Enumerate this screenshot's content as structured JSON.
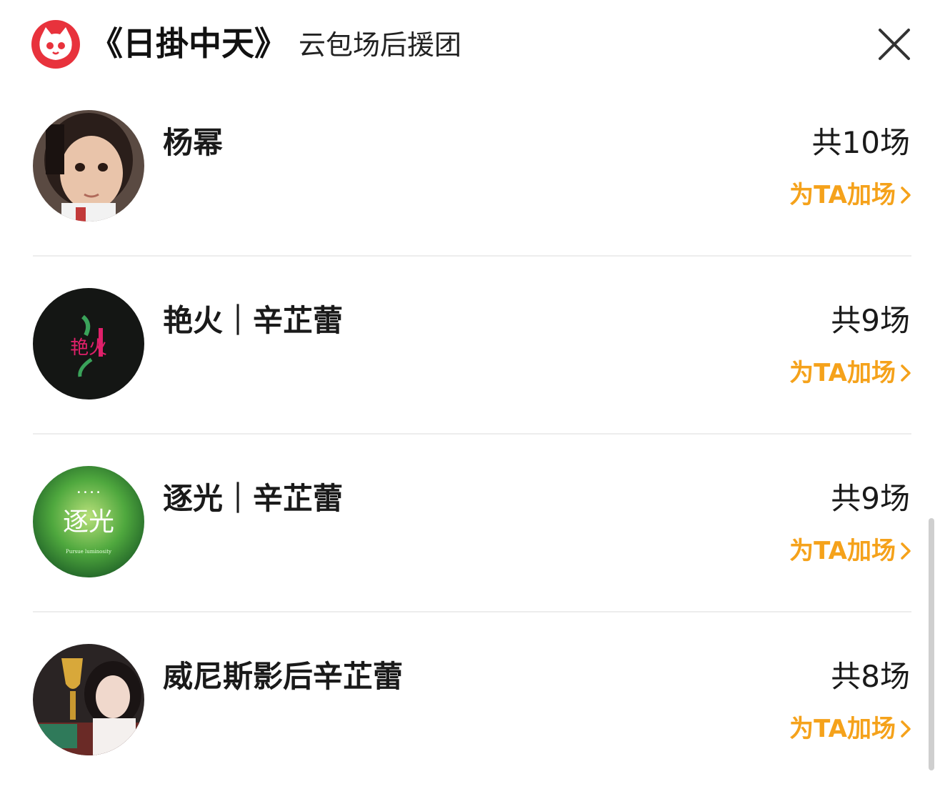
{
  "header": {
    "logo_icon": "maoyan-cat-logo",
    "movie_title": "《日掛中天》",
    "subtitle": "云包场后援团",
    "close_icon": "close-icon"
  },
  "accent_color": "#f5a21b",
  "brand_color": "#e8323c",
  "groups": [
    {
      "name": "杨幂",
      "count": "共10场",
      "action": "为TA加场",
      "avatar": "child-portrait-avatar"
    },
    {
      "name": "艳火｜辛芷蕾",
      "count": "共9场",
      "action": "为TA加场",
      "avatar": "yanhuo-logo-avatar",
      "avatar_text": "艳火"
    },
    {
      "name": "逐光｜辛芷蕾",
      "count": "共9场",
      "action": "为TA加场",
      "avatar": "zhuguang-logo-avatar",
      "avatar_text": "逐光",
      "avatar_subtext": "Pursue luminosity"
    },
    {
      "name": "威尼斯影后辛芷蕾",
      "count": "共8场",
      "action": "为TA加场",
      "avatar": "trophy-portrait-avatar"
    }
  ]
}
